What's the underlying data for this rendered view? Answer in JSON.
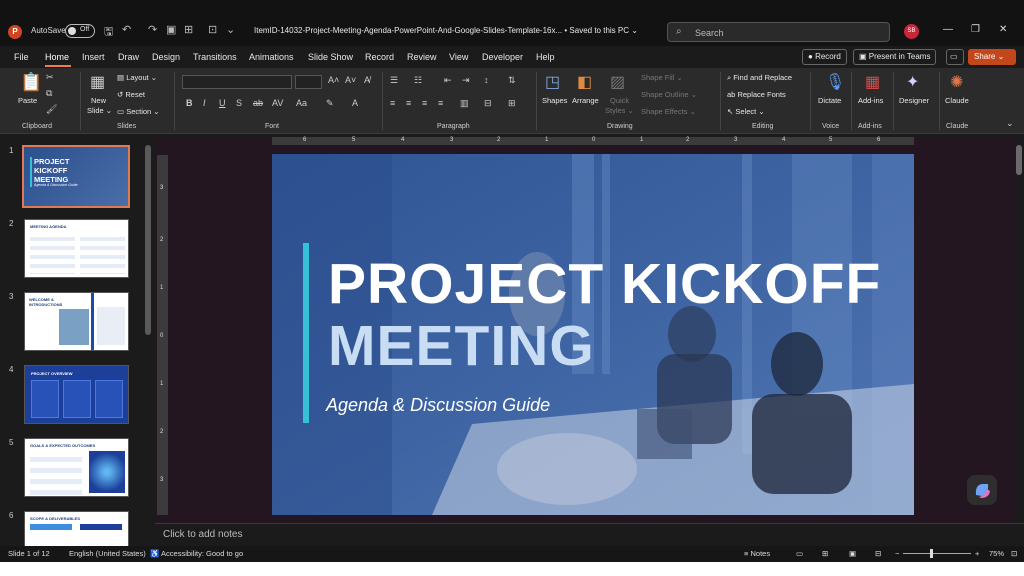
{
  "app": {
    "logo_letter": "P",
    "autosave_label": "AutoSave",
    "autosave_state": "Off",
    "filename": "ItemID-14032-Project-Meeting-Agenda-PowerPoint-And-Google-Slides-Template-16x...",
    "saved_status": "• Saved to this PC ⌄",
    "user_initials": "SB"
  },
  "search": {
    "placeholder": "Search"
  },
  "menu": {
    "items": [
      "File",
      "Home",
      "Insert",
      "Draw",
      "Design",
      "Transitions",
      "Animations",
      "Slide Show",
      "Record",
      "Review",
      "View",
      "Developer",
      "Help"
    ],
    "record_button": "Record",
    "present_button": "Present in Teams",
    "share_button": "Share"
  },
  "ribbon": {
    "clipboard": {
      "paste": "Paste",
      "group": "Clipboard"
    },
    "slides": {
      "new_slide_line1": "New",
      "new_slide_line2": "Slide ⌄",
      "layout": "Layout ⌄",
      "reset": "Reset",
      "section": "Section ⌄",
      "group": "Slides"
    },
    "font": {
      "group": "Font"
    },
    "paragraph": {
      "group": "Paragraph"
    },
    "drawing": {
      "shapes": "Shapes",
      "arrange": "Arrange",
      "quick_styles_1": "Quick",
      "quick_styles_2": "Styles ⌄",
      "shape_fill": "Shape Fill ⌄",
      "shape_outline": "Shape Outline ⌄",
      "shape_effects": "Shape Effects ⌄",
      "group": "Drawing"
    },
    "editing": {
      "find_replace": "Find and Replace",
      "replace_fonts": "Replace Fonts",
      "select": "Select ⌄",
      "group": "Editing"
    },
    "voice": {
      "dictate": "Dictate",
      "group": "Voice"
    },
    "addins": {
      "label": "Add-ins",
      "group": "Add-ins"
    },
    "designer": {
      "label": "Designer"
    },
    "claude": {
      "label": "Claude",
      "group": "Claude"
    }
  },
  "thumbnails": [
    {
      "num": "1",
      "title": "PROJECT KICKOFF MEETING",
      "subtitle": "Agenda & Discussion Guide"
    },
    {
      "num": "2",
      "title": "MEETING AGENDA"
    },
    {
      "num": "3",
      "title": "WELCOME & INTRODUCTIONS"
    },
    {
      "num": "4",
      "title": "PROJECT OVERVIEW"
    },
    {
      "num": "5",
      "title": "GOALS & EXPECTED OUTCOMES"
    },
    {
      "num": "6",
      "title": "SCOPE & DELIVERABLES"
    }
  ],
  "ruler": {
    "h": [
      "6",
      "5",
      "4",
      "3",
      "2",
      "1",
      "0",
      "1",
      "2",
      "3",
      "4",
      "5",
      "6"
    ],
    "v": [
      "3",
      "2",
      "1",
      "0",
      "1",
      "2",
      "3"
    ]
  },
  "slide": {
    "title_line1": "PROJECT KICKOFF",
    "title_line2": "MEETING",
    "subtitle": "Agenda & Discussion Guide"
  },
  "notes": {
    "placeholder": "Click to add notes"
  },
  "status": {
    "slide_info": "Slide 1 of 12",
    "language": "English (United States)",
    "accessibility": "Accessibility: Good to go",
    "notes": "Notes",
    "zoom": "75%"
  },
  "colors": {
    "accent": "#f07b53",
    "slide_overlay": "#3a5d99",
    "title_accent_bar": "#36c2d6",
    "share": "#c4471b"
  }
}
